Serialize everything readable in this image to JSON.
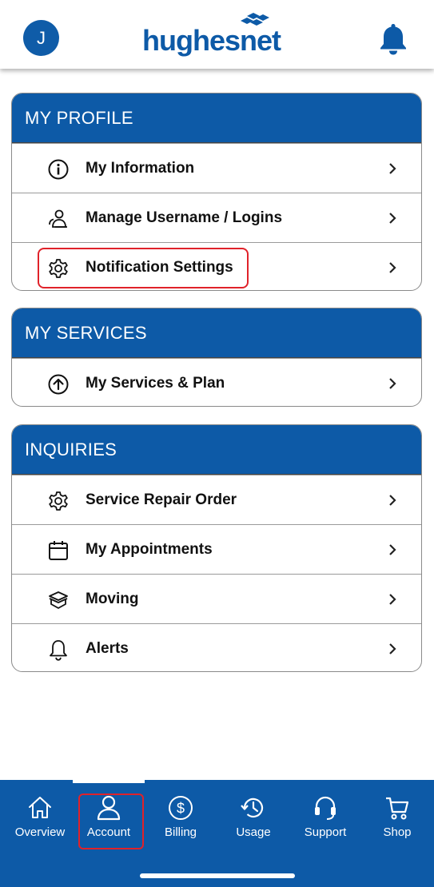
{
  "header": {
    "avatar_initial": "J",
    "logo_text": "hughesnet",
    "colors": {
      "brand_blue": "#0d5aa7",
      "highlight_red": "#e0222a"
    }
  },
  "sections": [
    {
      "title": "MY PROFILE",
      "items": [
        {
          "label": "My Information",
          "icon": "info-icon"
        },
        {
          "label": "Manage Username / Logins",
          "icon": "users-icon"
        },
        {
          "label": "Notification Settings",
          "icon": "gear-icon",
          "highlighted": true
        }
      ]
    },
    {
      "title": "MY SERVICES",
      "items": [
        {
          "label": "My Services & Plan",
          "icon": "arrow-up-circle-icon"
        }
      ]
    },
    {
      "title": "INQUIRIES",
      "items": [
        {
          "label": "Service Repair Order",
          "icon": "gear-icon"
        },
        {
          "label": "My Appointments",
          "icon": "calendar-icon"
        },
        {
          "label": "Moving",
          "icon": "box-icon"
        },
        {
          "label": "Alerts",
          "icon": "bell-icon"
        }
      ]
    }
  ],
  "bottom_nav": {
    "items": [
      {
        "label": "Overview",
        "icon": "home-icon"
      },
      {
        "label": "Account",
        "icon": "user-icon",
        "active": true,
        "highlighted": true
      },
      {
        "label": "Billing",
        "icon": "dollar-icon"
      },
      {
        "label": "Usage",
        "icon": "history-icon"
      },
      {
        "label": "Support",
        "icon": "headset-icon"
      },
      {
        "label": "Shop",
        "icon": "cart-icon"
      }
    ]
  }
}
